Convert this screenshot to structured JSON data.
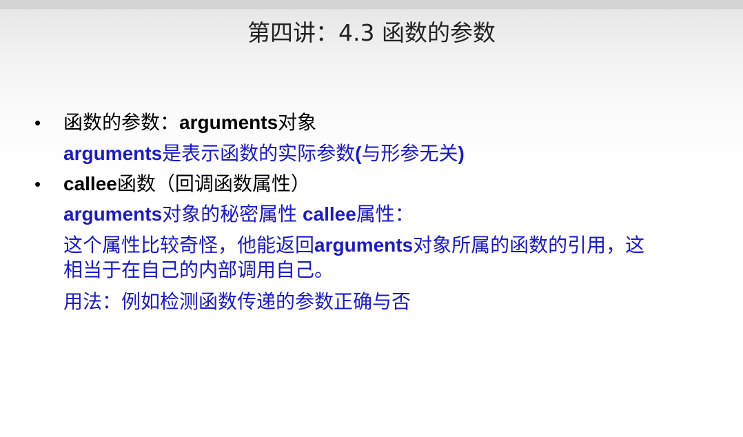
{
  "title": "第四讲：4.3 函数的参数",
  "bullet_char": "•",
  "items": [
    {
      "heading": [
        "函数的参数：",
        "arguments",
        "对象"
      ],
      "lines": [
        [
          "arguments",
          "是表示函数的实际参数",
          "(",
          "与形参无关",
          ")"
        ]
      ]
    },
    {
      "heading": [
        "callee",
        "函数（回调函数属性）"
      ],
      "lines": [
        [
          "arguments",
          "对象的秘密属性 ",
          "callee",
          "属性："
        ],
        [
          "这个属性比较奇怪，他能返回",
          "arguments",
          "对象所属的函数的引用，这"
        ],
        [
          "相当于在自己的内部调用自己。"
        ],
        [
          "用法：例如检测函数传递的参数正确与否"
        ]
      ]
    }
  ],
  "colors": {
    "heading_text": "#000000",
    "body_text": "#1a1acb",
    "title_text": "#222222"
  }
}
